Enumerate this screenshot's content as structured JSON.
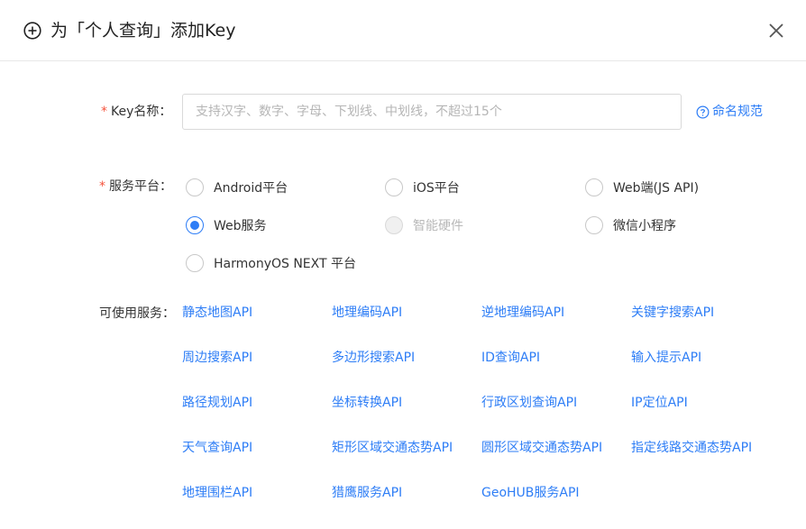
{
  "header": {
    "title": "为「个人查询」添加Key",
    "add_icon": "circle-plus-icon",
    "close_icon": "close-icon"
  },
  "form": {
    "key_name": {
      "required_mark": "*",
      "label": "Key名称：",
      "value": "",
      "placeholder": "支持汉字、数字、字母、下划线、中划线，不超过15个",
      "help_link": "命名规范",
      "help_icon": "question-circle-icon"
    },
    "platform": {
      "required_mark": "*",
      "label": "服务平台：",
      "options": [
        {
          "label": "Android平台",
          "checked": false,
          "disabled": false
        },
        {
          "label": "iOS平台",
          "checked": false,
          "disabled": false
        },
        {
          "label": "Web端(JS API)",
          "checked": false,
          "disabled": false
        },
        {
          "label": "Web服务",
          "checked": true,
          "disabled": false
        },
        {
          "label": "智能硬件",
          "checked": false,
          "disabled": true
        },
        {
          "label": "微信小程序",
          "checked": false,
          "disabled": false
        },
        {
          "label": "HarmonyOS NEXT 平台",
          "checked": false,
          "disabled": false
        }
      ]
    },
    "services": {
      "label": "可使用服务：",
      "items": [
        "静态地图API",
        "地理编码API",
        "逆地理编码API",
        "关键字搜索API",
        "周边搜索API",
        "多边形搜索API",
        "ID查询API",
        "输入提示API",
        "路径规划API",
        "坐标转换API",
        "行政区划查询API",
        "IP定位API",
        "天气查询API",
        "矩形区域交通态势API",
        "圆形区域交通态势API",
        "指定线路交通态势API",
        "地理围栏API",
        "猎鹰服务API",
        "GeoHUB服务API"
      ]
    }
  },
  "colors": {
    "accent": "#2d7df6",
    "required": "#f5533d",
    "disabled_text": "#b9b9b9"
  }
}
